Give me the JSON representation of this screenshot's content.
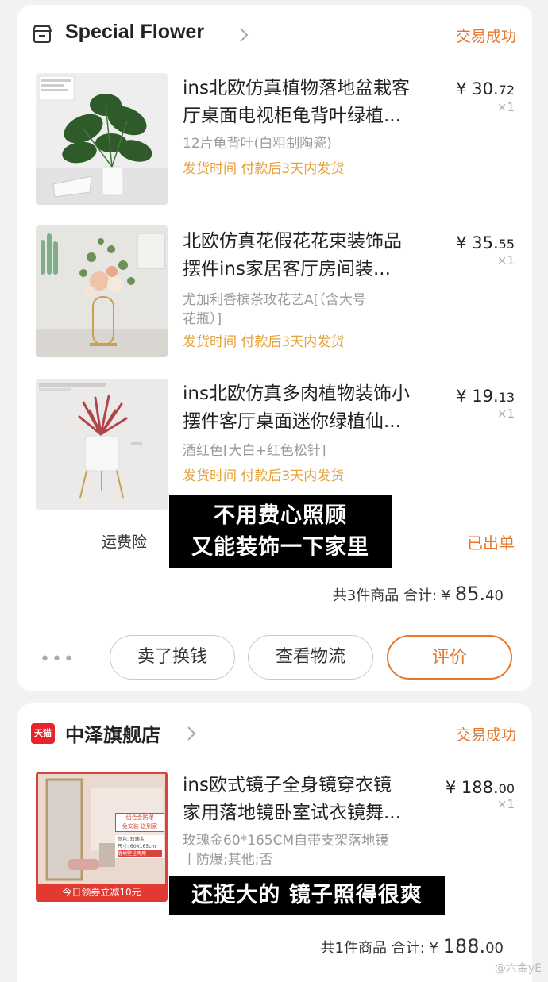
{
  "orders": [
    {
      "shop_name": "Special Flower",
      "status": "交易成功",
      "items": [
        {
          "title": "ins北欧仿真植物落地盆栽客厅桌面电视柜龟背叶绿植...",
          "title_line1": "ins北欧仿真植物落地盆栽客",
          "title_line2": "厅桌面电视柜龟背叶绿植...",
          "variant": "12片龟背叶(白粗制陶瓷)",
          "shipping": "发货时间  付款后3天内发货",
          "price_int": "¥ 30.",
          "price_dec": "72",
          "qty": "×1"
        },
        {
          "title": "北欧仿真花假花花束装饰品摆件ins家居客厅房间装...",
          "title_line1": "北欧仿真花假花花束装饰品",
          "title_line2": "摆件ins家居客厅房间装...",
          "variant": "尤加利香槟茶玫花艺A[（含大号花瓶）]",
          "variant_line1": "尤加利香槟茶玫花艺A[（含大号",
          "variant_line2": "花瓶）]",
          "shipping": "发货时间  付款后3天内发货",
          "price_int": "¥ 35.",
          "price_dec": "55",
          "qty": "×1"
        },
        {
          "title": "ins北欧仿真多肉植物装饰小摆件客厅桌面迷你绿植仙...",
          "title_line1": "ins北欧仿真多肉植物装饰小",
          "title_line2": "摆件客厅桌面迷你绿植仙...",
          "variant": "酒红色[大白+红色松针]",
          "shipping": "发货时间  付款后3天内发货",
          "price_int": "¥ 19.",
          "price_dec": "13",
          "qty": "×1"
        }
      ],
      "caption_line1": "不用费心照顾",
      "caption_line2": "又能装饰一下家里",
      "freight_label": "运费险",
      "freight_status": "已出单",
      "total_text": "共3件商品  合计: ¥ ",
      "total_int": "85.",
      "total_dec": "40",
      "more_icon": "more-dots-icon",
      "buttons": {
        "sell": "卖了换钱",
        "logistics": "查看物流",
        "review": "评价"
      }
    },
    {
      "shop_name": "中泽旗舰店",
      "shop_badge": "天猫",
      "status": "交易成功",
      "items": [
        {
          "title": "ins欧式镜子全身镜穿衣镜家用落地镜卧室试衣镜舞...",
          "title_line1": "ins欧式镜子全身镜穿衣镜",
          "title_line2": "家用落地镜卧室试衣镜舞...",
          "variant": "玫瑰金60*165CM自带支架落地镜丨防爆;其他;否",
          "variant_line1": "玫瑰金60*165CM自带支架落地镜",
          "variant_line2": "丨防爆;其他;否",
          "price_int": "¥ 188.",
          "price_dec": "00",
          "qty": "×1",
          "thumb_banner": "今日领券立减10元",
          "thumb_tag1": "组合金防爆",
          "thumb_tag2": "免安装 送到家",
          "thumb_spec_color": "颜色: 玫瑰金",
          "thumb_spec_size": "尺寸: 60X165cm",
          "thumb_spec_note": "落地壁挂两用"
        }
      ],
      "caption": "还挺大的 镜子照得很爽",
      "total_text": "共1件商品  合计: ¥ ",
      "total_int": "188.",
      "total_dec": "00"
    }
  ],
  "watermark": "@六金yE",
  "colors": {
    "accent": "#e6772e",
    "shipping": "#e6a23c",
    "tmall": "#e8232c"
  }
}
